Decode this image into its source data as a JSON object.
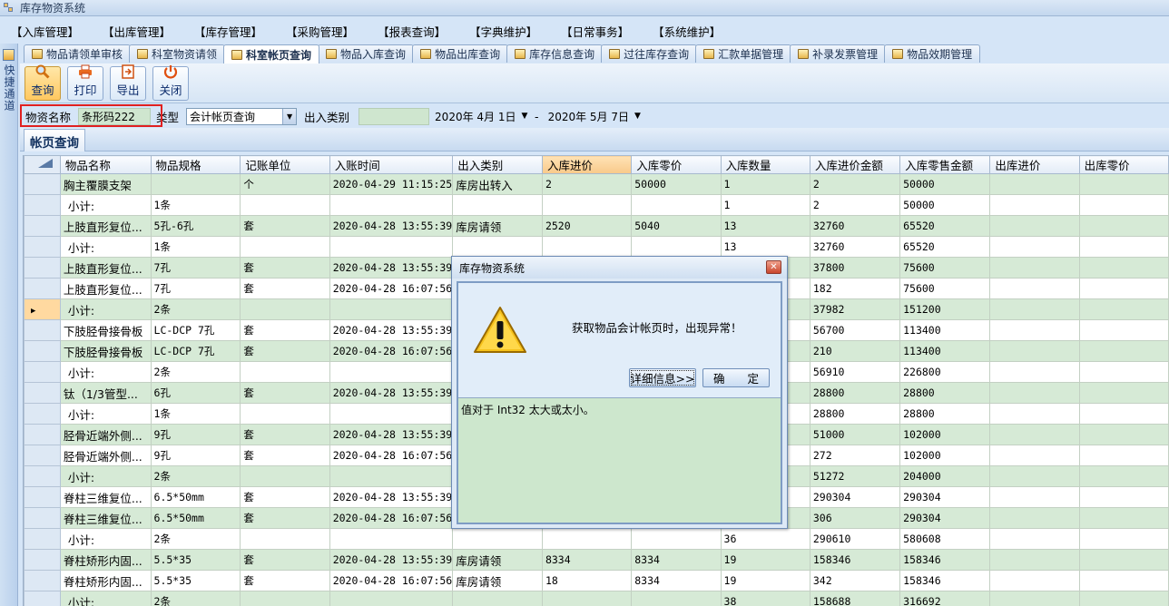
{
  "window": {
    "title": "库存物资系统"
  },
  "menu": [
    "【入库管理】",
    "【出库管理】",
    "【库存管理】",
    "【采购管理】",
    "【报表查询】",
    "【字典维护】",
    "【日常事务】",
    "【系统维护】"
  ],
  "leftstrip": {
    "label": "快捷通道"
  },
  "tabs": [
    {
      "label": "物品请领单审核",
      "active": false
    },
    {
      "label": "科室物资请领",
      "active": false
    },
    {
      "label": "科室帐页查询",
      "active": true
    },
    {
      "label": "物品入库查询",
      "active": false
    },
    {
      "label": "物品出库查询",
      "active": false
    },
    {
      "label": "库存信息查询",
      "active": false
    },
    {
      "label": "过往库存查询",
      "active": false
    },
    {
      "label": "汇款单据管理",
      "active": false
    },
    {
      "label": "补录发票管理",
      "active": false
    },
    {
      "label": "物品效期管理",
      "active": false
    }
  ],
  "toolbar": {
    "query": "查询",
    "print": "打印",
    "export": "导出",
    "close": "关闭"
  },
  "filters": {
    "item_name_label": "物资名称",
    "item_name_value": "条形码222",
    "type_label": "类型",
    "type_value": "会计帐页查询",
    "io_type_label": "出入类别",
    "io_type_value": "",
    "date_from": "2020年 4月 1日",
    "date_sep": "-",
    "date_to": "2020年 5月 7日"
  },
  "section": {
    "title": "帐页查询"
  },
  "grid": {
    "columns": [
      "物品名称",
      "物品规格",
      "记账单位",
      "入账时间",
      "出入类别",
      "入库进价",
      "入库零价",
      "入库数量",
      "入库进价金额",
      "入库零售金额",
      "出库进价",
      "出库零价"
    ],
    "sorted_column": 5,
    "current_row": 6,
    "rows": [
      [
        "胸主覆膜支架",
        "",
        "个",
        "2020-04-29 11:15:25",
        "库房出转入",
        "2",
        "50000",
        "1",
        "2",
        "50000",
        "",
        ""
      ],
      [
        "小计:",
        "1条",
        "",
        "",
        "",
        "",
        "",
        "1",
        "2",
        "50000",
        "",
        ""
      ],
      [
        "上肢直形复位...",
        "5孔-6孔",
        "套",
        "2020-04-28 13:55:39",
        "库房请领",
        "2520",
        "5040",
        "13",
        "32760",
        "65520",
        "",
        ""
      ],
      [
        "小计:",
        "1条",
        "",
        "",
        "",
        "",
        "",
        "13",
        "32760",
        "65520",
        "",
        ""
      ],
      [
        "上肢直形复位...",
        "7孔",
        "套",
        "2020-04-28 13:55:39",
        "",
        "",
        "",
        "",
        "37800",
        "75600",
        "",
        ""
      ],
      [
        "上肢直形复位...",
        "7孔",
        "套",
        "2020-04-28 16:07:56",
        "",
        "",
        "",
        "",
        "182",
        "75600",
        "",
        ""
      ],
      [
        "小计:",
        "2条",
        "",
        "",
        "",
        "",
        "",
        "",
        "37982",
        "151200",
        "",
        ""
      ],
      [
        "下肢胫骨接骨板",
        "LC-DCP 7孔",
        "套",
        "2020-04-28 13:55:39",
        "",
        "",
        "",
        "",
        "56700",
        "113400",
        "",
        ""
      ],
      [
        "下肢胫骨接骨板",
        "LC-DCP 7孔",
        "套",
        "2020-04-28 16:07:56",
        "",
        "",
        "",
        "",
        "210",
        "113400",
        "",
        ""
      ],
      [
        "小计:",
        "2条",
        "",
        "",
        "",
        "",
        "",
        "",
        "56910",
        "226800",
        "",
        ""
      ],
      [
        "钛（1/3管型...",
        "6孔",
        "套",
        "2020-04-28 13:55:39",
        "",
        "",
        "",
        "",
        "28800",
        "28800",
        "",
        ""
      ],
      [
        "小计:",
        "1条",
        "",
        "",
        "",
        "",
        "",
        "",
        "28800",
        "28800",
        "",
        ""
      ],
      [
        "胫骨近端外侧...",
        "9孔",
        "套",
        "2020-04-28 13:55:39",
        "",
        "",
        "",
        "",
        "51000",
        "102000",
        "",
        ""
      ],
      [
        "胫骨近端外侧...",
        "9孔",
        "套",
        "2020-04-28 16:07:56",
        "",
        "",
        "",
        "",
        "272",
        "102000",
        "",
        ""
      ],
      [
        "小计:",
        "2条",
        "",
        "",
        "",
        "",
        "",
        "",
        "51272",
        "204000",
        "",
        ""
      ],
      [
        "脊柱三维复位...",
        "6.5*50mm",
        "套",
        "2020-04-28 13:55:39",
        "",
        "",
        "",
        "",
        "290304",
        "290304",
        "",
        ""
      ],
      [
        "脊柱三维复位...",
        "6.5*50mm",
        "套",
        "2020-04-28 16:07:56",
        "",
        "",
        "",
        "",
        "306",
        "290304",
        "",
        ""
      ],
      [
        "小计:",
        "2条",
        "",
        "",
        "",
        "",
        "",
        "36",
        "290610",
        "580608",
        "",
        ""
      ],
      [
        "脊柱矫形内固...",
        "5.5*35",
        "套",
        "2020-04-28 13:55:39",
        "库房请领",
        "8334",
        "8334",
        "19",
        "158346",
        "158346",
        "",
        ""
      ],
      [
        "脊柱矫形内固...",
        "5.5*35",
        "套",
        "2020-04-28 16:07:56",
        "库房请领",
        "18",
        "8334",
        "19",
        "342",
        "158346",
        "",
        ""
      ],
      [
        "小计:",
        "2条",
        "",
        "",
        "",
        "",
        "",
        "38",
        "158688",
        "316692",
        "",
        ""
      ]
    ]
  },
  "dialog": {
    "title": "库存物资系统",
    "message": "获取物品会计帐页时，出现异常！",
    "details_button": "详细信息>>",
    "ok_button": "确　　定",
    "detail_text": "值对于 Int32 太大或太小。"
  }
}
